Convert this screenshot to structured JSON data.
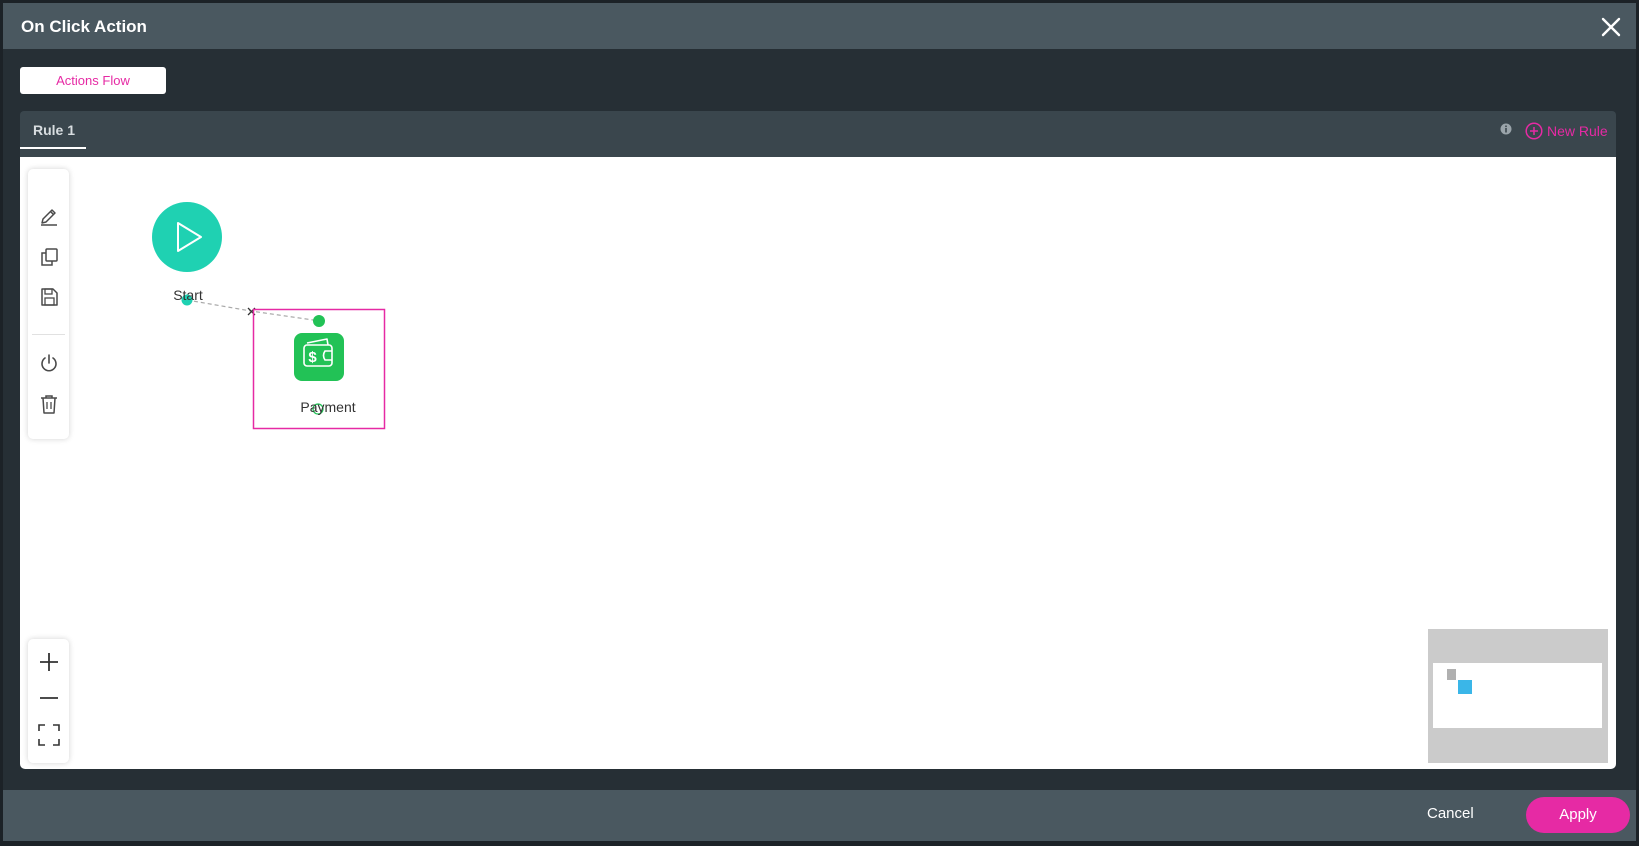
{
  "dialog": {
    "title": "On Click Action"
  },
  "tabs": {
    "actions_flow_label": "Actions Flow"
  },
  "rules": {
    "active_rule_label": "Rule 1",
    "new_rule_label": "New Rule"
  },
  "toolbar": {
    "tools": [
      "pencil-icon",
      "copy-icon",
      "save-icon",
      "power-icon",
      "trash-icon"
    ]
  },
  "zoom": {
    "tools": [
      "zoom-in-icon",
      "zoom-out-icon",
      "fit-screen-icon"
    ]
  },
  "flow": {
    "nodes": [
      {
        "id": "start",
        "label": "Start",
        "icon": "play-icon",
        "color": "#1fd1b2"
      },
      {
        "id": "payment",
        "label": "Payment",
        "icon": "wallet-icon",
        "color": "#22c256",
        "selected": true
      }
    ],
    "connections": [
      {
        "from": "start",
        "to": "payment",
        "style": "dashed"
      }
    ]
  },
  "footer": {
    "cancel_label": "Cancel",
    "apply_label": "Apply"
  },
  "colors": {
    "accent": "#e62aa4",
    "header": "#4a5860",
    "body": "#262f35",
    "start_node": "#1fd1b2",
    "payment_node": "#22c256",
    "minimap_node": "#3ab6e8"
  }
}
